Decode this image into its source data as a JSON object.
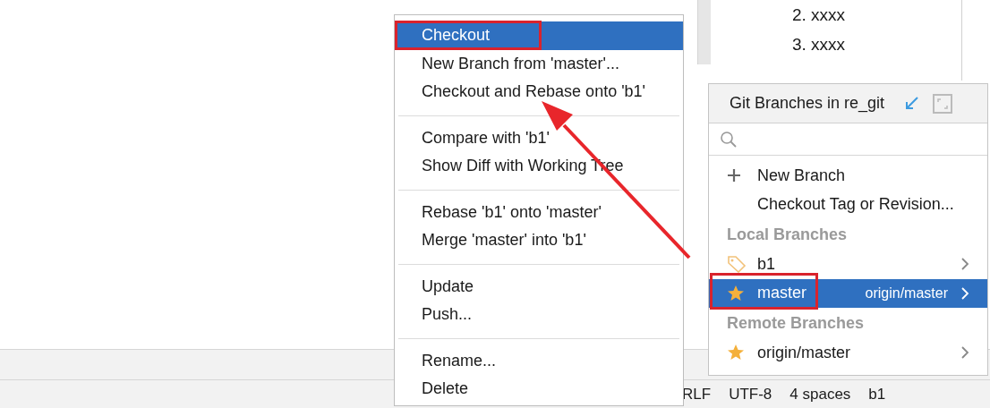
{
  "editor": {
    "lines": [
      "2. xxxx",
      "3. xxxx"
    ]
  },
  "context_menu": {
    "groups": [
      [
        {
          "label": "Checkout",
          "selected": true
        },
        {
          "label": "New Branch from 'master'...",
          "selected": false
        },
        {
          "label": "Checkout and Rebase onto 'b1'",
          "selected": false
        }
      ],
      [
        {
          "label": "Compare with 'b1'",
          "selected": false
        },
        {
          "label": "Show Diff with Working Tree",
          "selected": false
        }
      ],
      [
        {
          "label": "Rebase 'b1' onto 'master'",
          "selected": false
        },
        {
          "label": "Merge 'master' into 'b1'",
          "selected": false
        }
      ],
      [
        {
          "label": "Update",
          "selected": false
        },
        {
          "label": "Push...",
          "selected": false
        }
      ],
      [
        {
          "label": "Rename...",
          "selected": false
        },
        {
          "label": "Delete",
          "selected": false
        }
      ]
    ]
  },
  "branches_popup": {
    "title": "Git Branches in re_git",
    "items": [
      {
        "kind": "create",
        "label": "New Branch"
      },
      {
        "kind": "action",
        "label": "Checkout Tag or Revision..."
      },
      {
        "kind": "header",
        "label": "Local Branches"
      },
      {
        "kind": "branch",
        "label": "b1",
        "favorite": false,
        "selected": false
      },
      {
        "kind": "branch",
        "label": "master",
        "tracking": "origin/master",
        "favorite": true,
        "selected": true
      },
      {
        "kind": "header",
        "label": "Remote Branches"
      },
      {
        "kind": "branch",
        "label": "origin/master",
        "favorite": true,
        "selected": false
      }
    ]
  },
  "status_bar": {
    "items": [
      "RLF",
      "UTF-8",
      "4 spaces",
      "b1"
    ]
  }
}
